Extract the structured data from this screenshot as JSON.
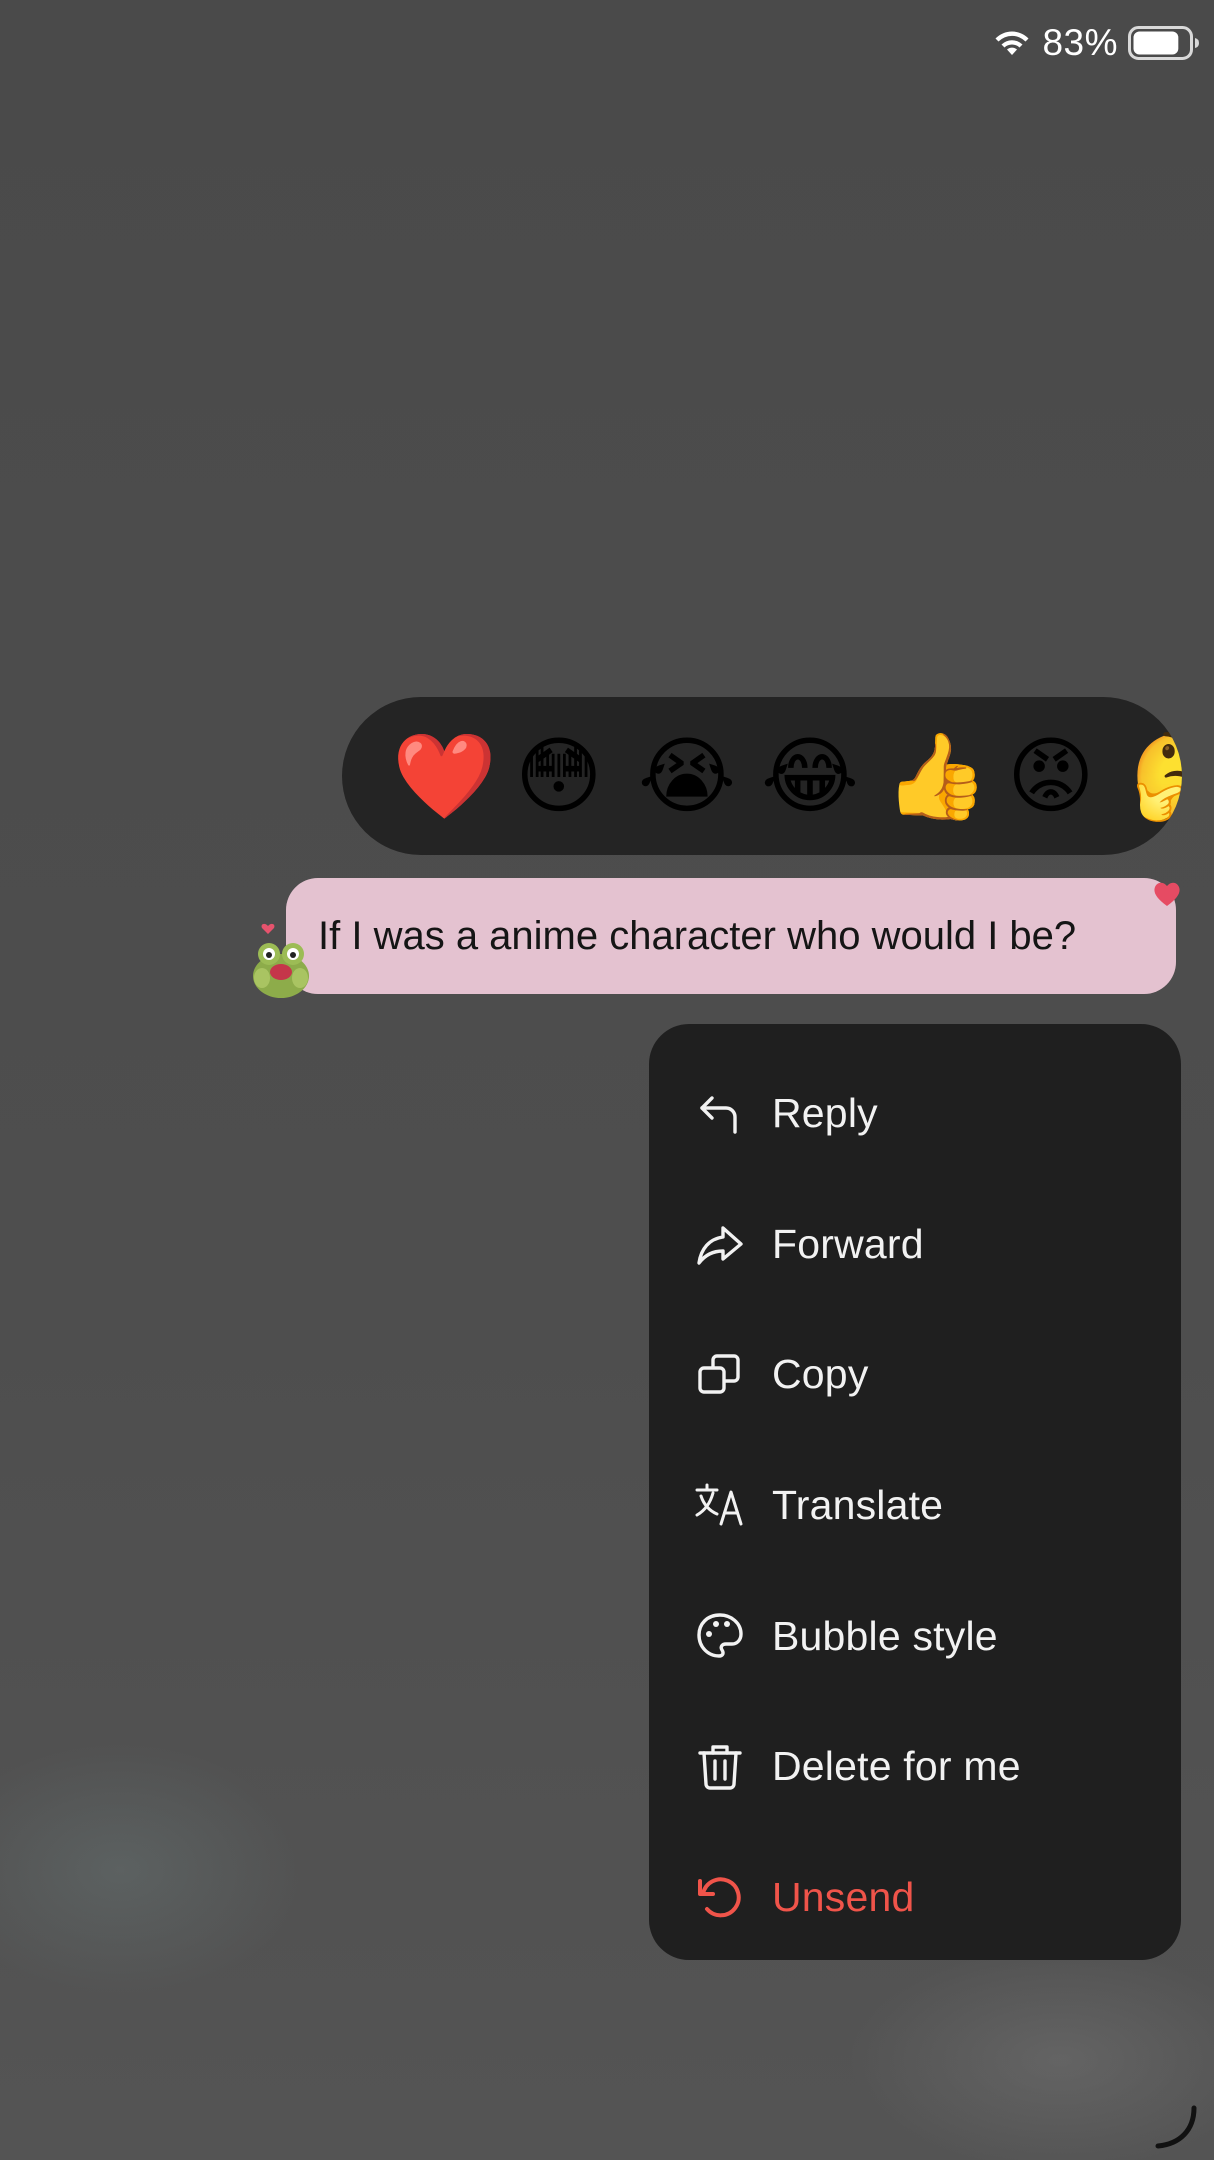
{
  "status_bar": {
    "battery_percent": "83%",
    "battery_level": 0.83
  },
  "reactions": [
    {
      "emoji": "❤️",
      "name": "heart"
    },
    {
      "emoji": "😳",
      "name": "flushed"
    },
    {
      "emoji": "😭",
      "name": "crying"
    },
    {
      "emoji": "😂",
      "name": "laughing"
    },
    {
      "emoji": "👍",
      "name": "thumbs-up"
    },
    {
      "emoji": "😡",
      "name": "angry"
    },
    {
      "emoji": "🤔",
      "name": "thinking"
    }
  ],
  "message": {
    "text": "If I was a anime character who would I be?",
    "bubble_color": "#e4c2d0"
  },
  "menu": {
    "items": [
      {
        "label": "Reply",
        "icon": "reply-icon"
      },
      {
        "label": "Forward",
        "icon": "forward-icon"
      },
      {
        "label": "Copy",
        "icon": "copy-icon"
      },
      {
        "label": "Translate",
        "icon": "translate-icon"
      },
      {
        "label": "Bubble style",
        "icon": "palette-icon"
      },
      {
        "label": "Delete for me",
        "icon": "trash-icon"
      },
      {
        "label": "Unsend",
        "icon": "undo-icon",
        "color": "#f0544a"
      }
    ]
  }
}
